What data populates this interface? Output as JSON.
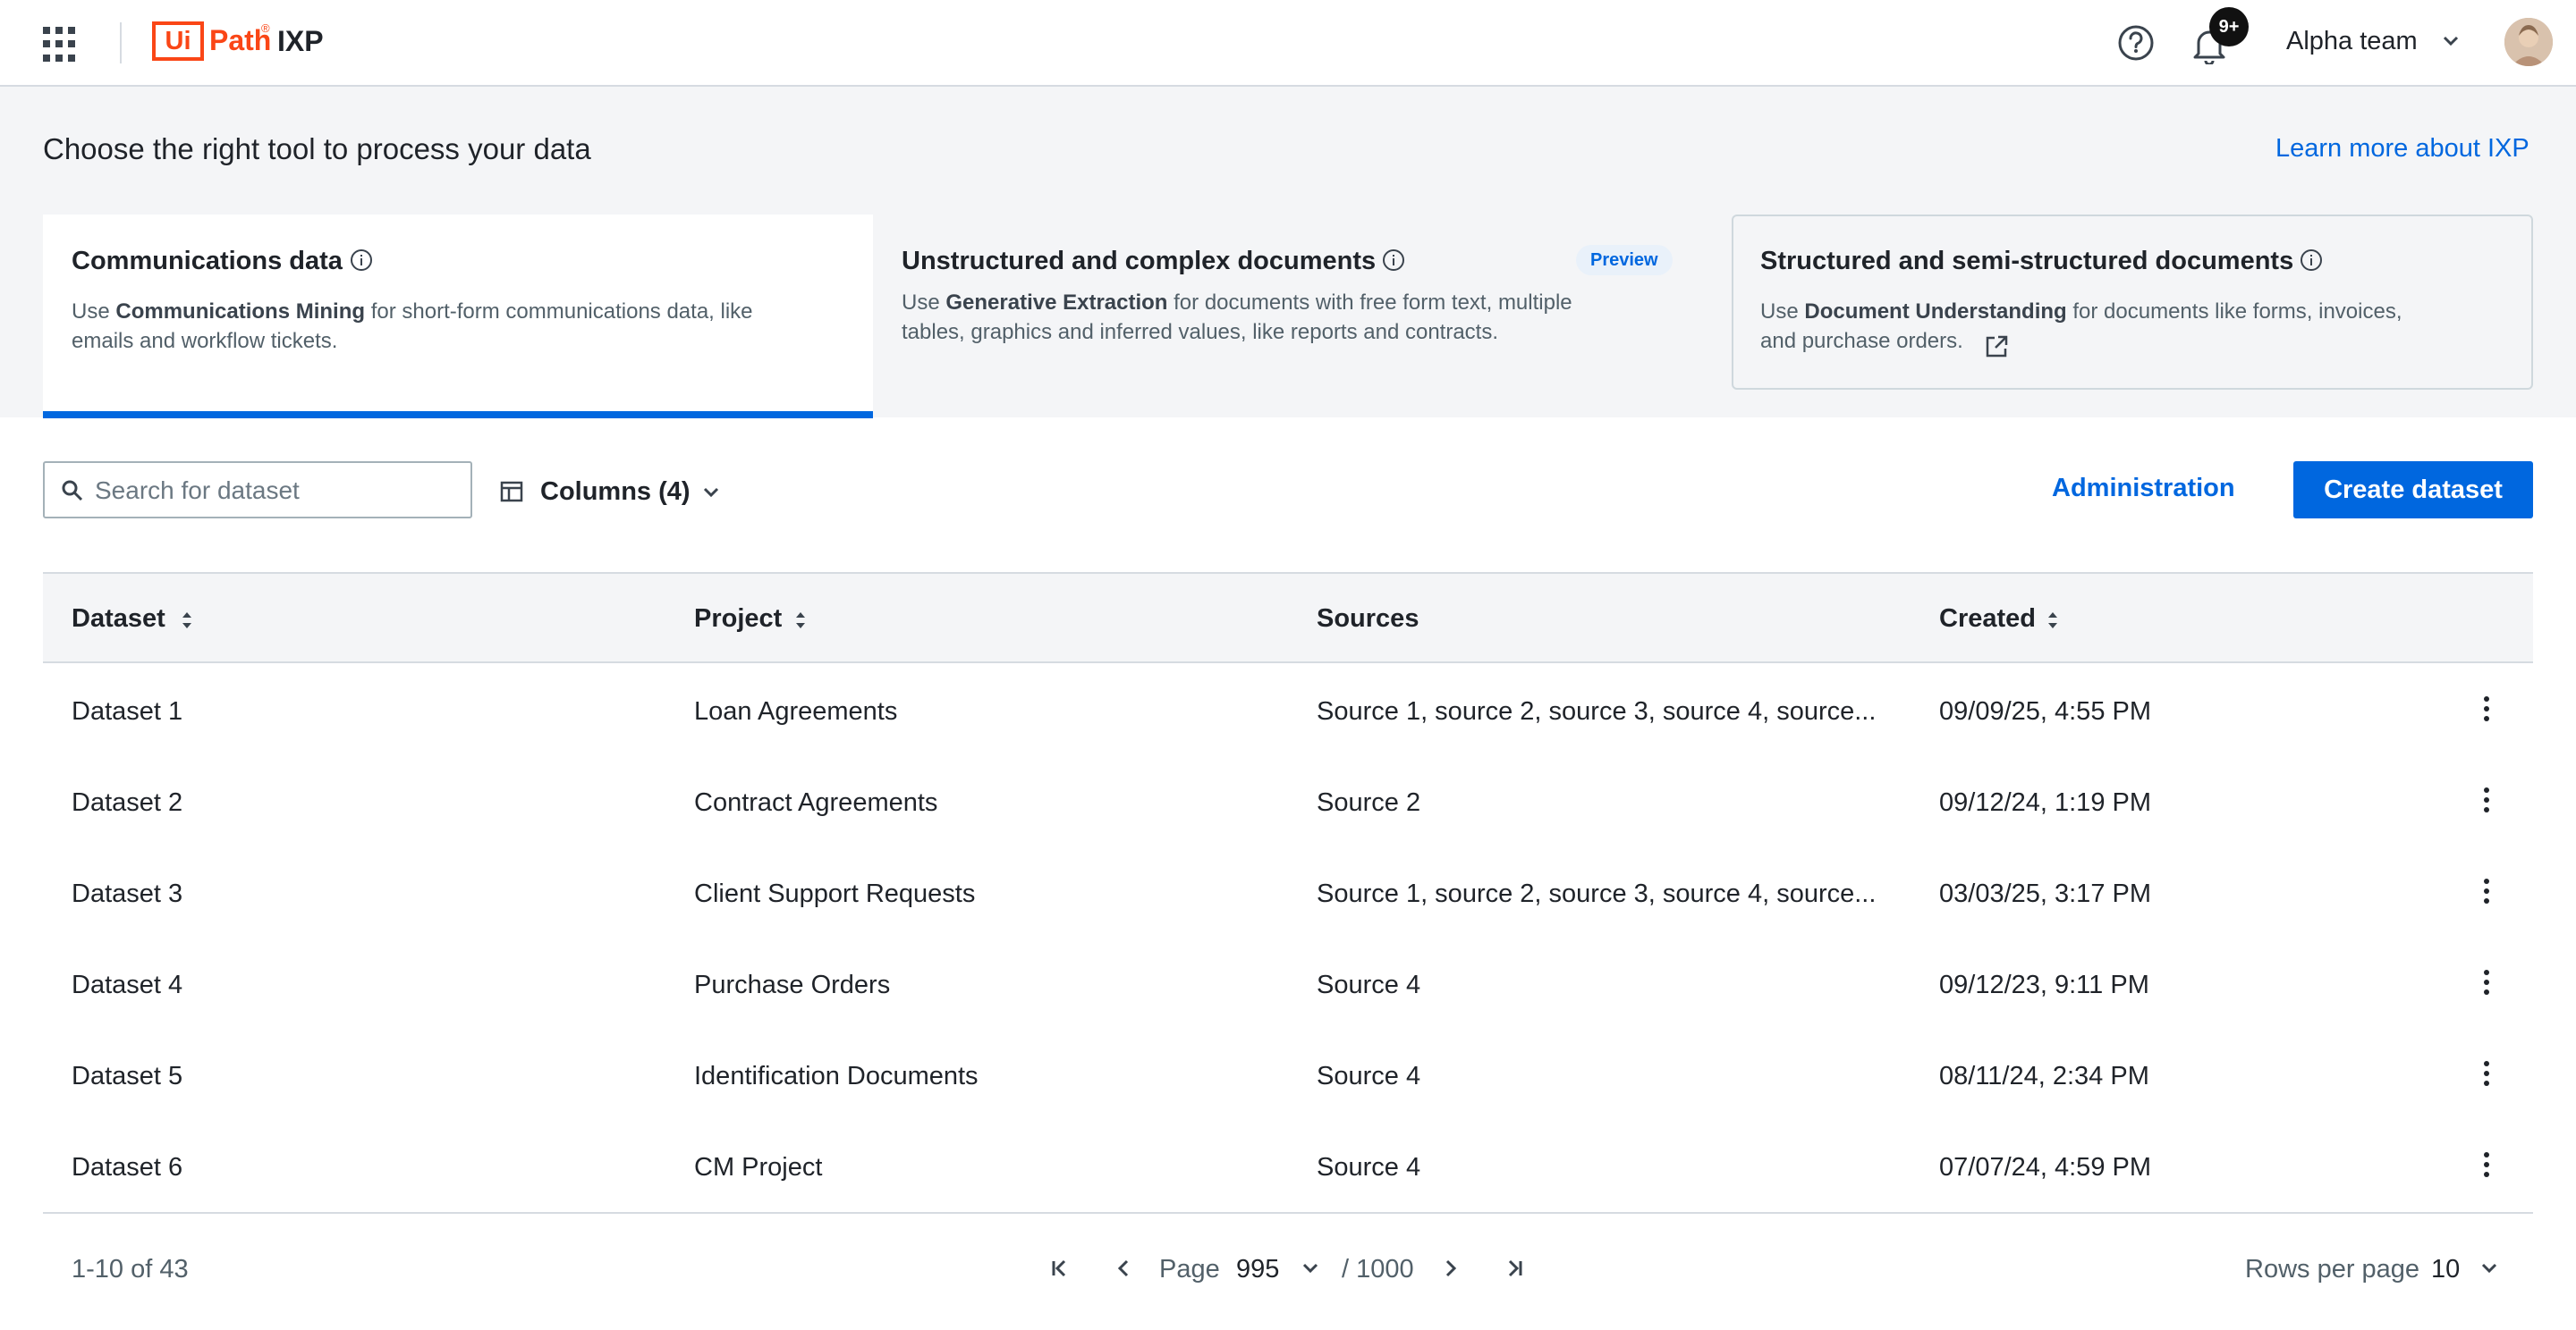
{
  "header": {
    "logo_box": "Ui",
    "logo_rest": "Path",
    "logo_reg": "®",
    "product": "IXP",
    "notification_badge": "9+",
    "team": "Alpha team",
    "icons": [
      "apps-grid-icon",
      "help-icon",
      "bell-icon",
      "chevron-down-icon",
      "avatar"
    ]
  },
  "banner": {
    "title": "Choose the right tool to process your data",
    "learn_more": "Learn more about IXP",
    "cards": [
      {
        "title": "Communications data",
        "desc_prefix": "Use ",
        "desc_bold": "Communications Mining",
        "desc_line1_rest": " for short-form communications data, like",
        "desc_line2": "emails and workflow tickets.",
        "selected": true
      },
      {
        "title": "Unstructured and complex documents",
        "badge": "Preview",
        "desc_prefix": "Use ",
        "desc_bold": "Generative Extraction",
        "desc_line1_rest": " for documents with free form text, multiple",
        "desc_line2": "tables, graphics and inferred values, like reports and contracts."
      },
      {
        "title": "Structured and semi-structured documents",
        "desc_prefix": "Use ",
        "desc_bold": "Document Understanding",
        "desc_line1_rest": " for documents like forms, invoices,",
        "desc_line2": "and purchase orders."
      }
    ]
  },
  "toolbar": {
    "search_placeholder": "Search for dataset",
    "search_value": "",
    "columns_label": "Columns (4)",
    "administration": "Administration",
    "create": "Create dataset"
  },
  "table": {
    "columns": [
      "Dataset",
      "Project",
      "Sources",
      "Created"
    ],
    "rows": [
      [
        "Dataset 1",
        "Loan Agreements",
        "Source 1, source 2, source 3, source 4, source...",
        "09/09/25, 4:55 PM"
      ],
      [
        "Dataset 2",
        "Contract Agreements",
        "Source 2",
        "09/12/24, 1:19 PM"
      ],
      [
        "Dataset 3",
        "Client Support Requests",
        "Source 1, source 2, source 3, source 4, source...",
        "03/03/25, 3:17 PM"
      ],
      [
        "Dataset 4",
        "Purchase Orders",
        "Source 4",
        "09/12/23, 9:11 PM"
      ],
      [
        "Dataset 5",
        "Identification Documents",
        "Source 4",
        "08/11/24, 2:34 PM"
      ],
      [
        "Dataset 6",
        "CM Project",
        "Source 4",
        "07/07/24, 4:59 PM"
      ]
    ]
  },
  "footer": {
    "range": "1-10 of 43",
    "page_label": "Page",
    "page_value": "995",
    "page_total": "/ 1000",
    "rows_label": "Rows per page",
    "rows_value": "10"
  },
  "colors": {
    "accent": "#0067df",
    "brand": "#fa4616",
    "banner_bg": "#f4f5f7"
  }
}
